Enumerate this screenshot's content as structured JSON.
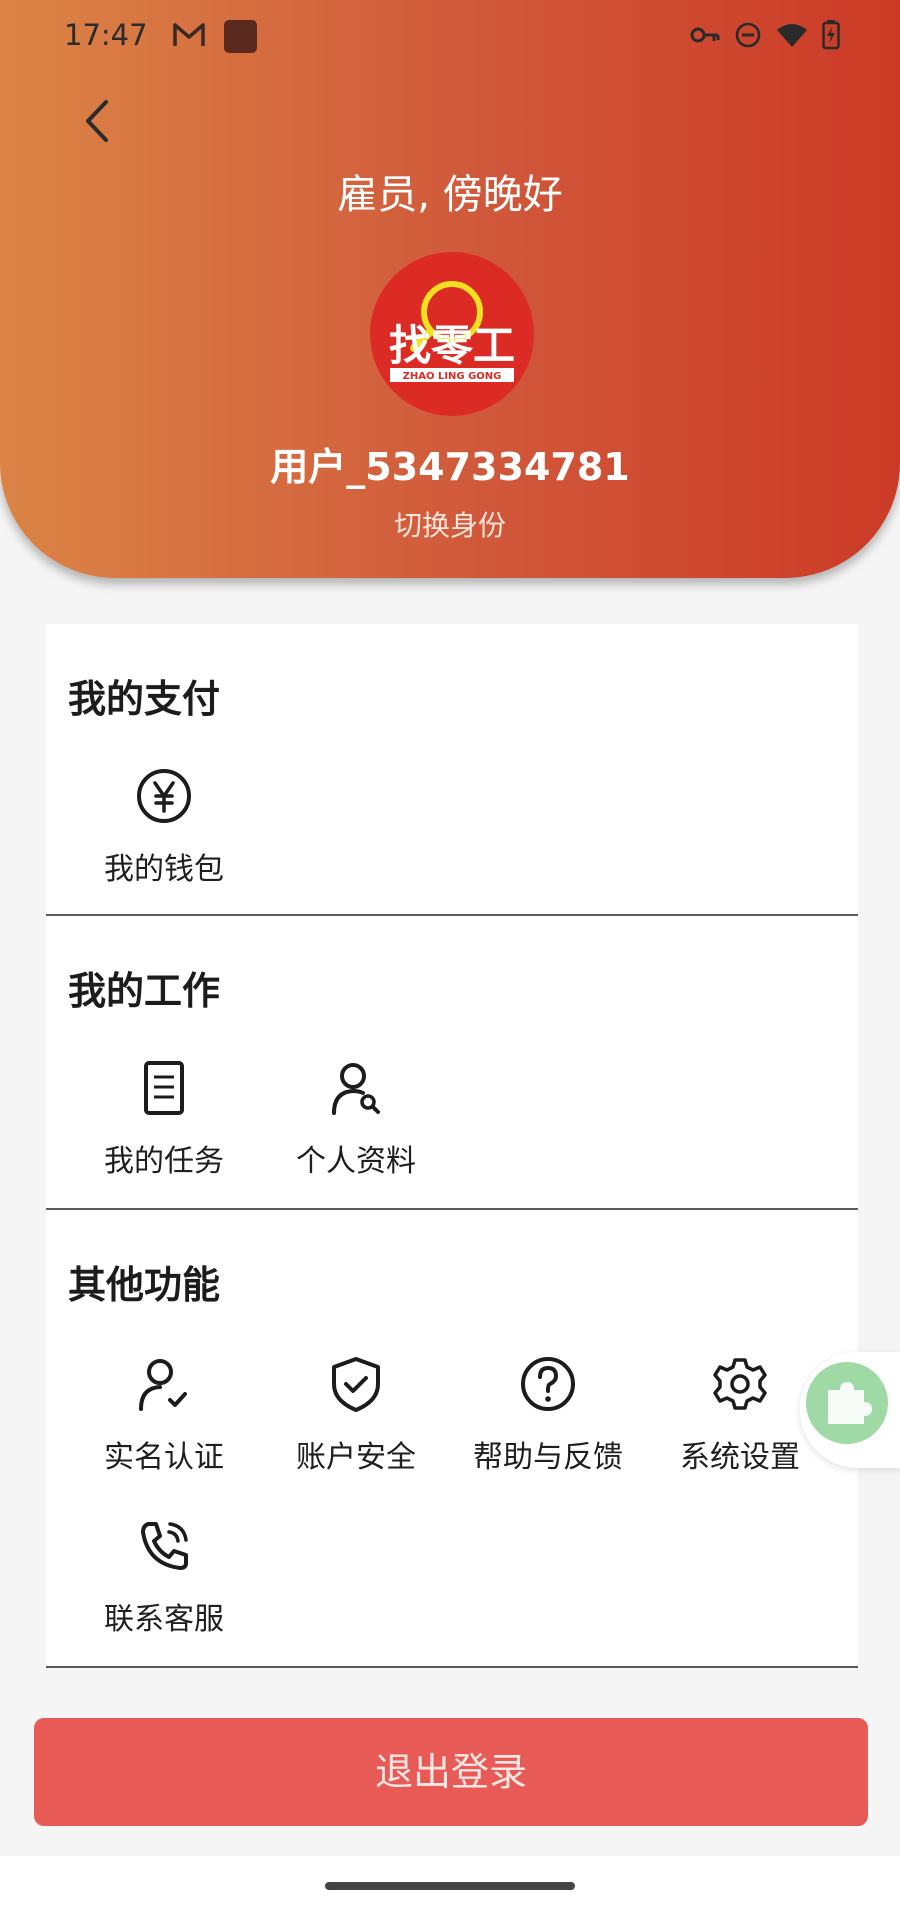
{
  "status_bar": {
    "time": "17:47"
  },
  "header": {
    "greeting": "雇员, 傍晚好",
    "username": "用户_5347334781",
    "switch_identity": "切换身份",
    "logo": {
      "main_text": "找零工",
      "sub_text": "ZHAO LING GONG"
    }
  },
  "sections": {
    "payment": {
      "title": "我的支付",
      "items": [
        {
          "label": "我的钱包",
          "icon": "yuan-circle-icon"
        }
      ]
    },
    "work": {
      "title": "我的工作",
      "items": [
        {
          "label": "我的任务",
          "icon": "document-icon"
        },
        {
          "label": "个人资料",
          "icon": "user-search-icon"
        }
      ]
    },
    "other": {
      "title": "其他功能",
      "items": [
        {
          "label": "实名认证",
          "icon": "user-check-icon"
        },
        {
          "label": "账户安全",
          "icon": "shield-check-icon"
        },
        {
          "label": "帮助与反馈",
          "icon": "question-circle-icon"
        },
        {
          "label": "系统设置",
          "icon": "gear-icon"
        },
        {
          "label": "联系客服",
          "icon": "phone-call-icon"
        }
      ]
    }
  },
  "logout_label": "退出登录",
  "colors": {
    "header_start": "#db8446",
    "header_end": "#cc3a26",
    "logout": "#e85a55",
    "plugin": "#9ed9a6"
  }
}
